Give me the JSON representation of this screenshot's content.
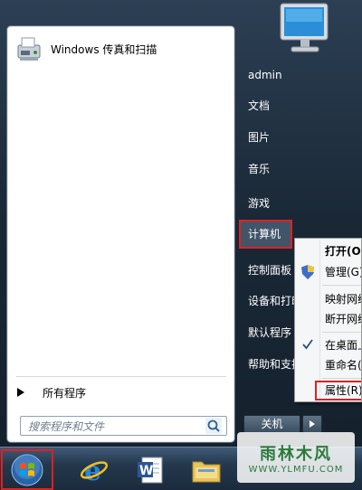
{
  "start_menu": {
    "pinned_item_label": "Windows 传真和扫描",
    "all_programs_label": "所有程序",
    "search_placeholder": "搜索程序和文件"
  },
  "right_pane": {
    "items": [
      {
        "label": "admin"
      },
      {
        "label": "文档"
      },
      {
        "label": "图片"
      },
      {
        "label": "音乐"
      },
      {
        "label": "游戏"
      },
      {
        "label": "计算机"
      },
      {
        "label": "控制面板"
      },
      {
        "label": "设备和打印机"
      },
      {
        "label": "默认程序"
      },
      {
        "label": "帮助和支持"
      }
    ],
    "shutdown_label": "关机"
  },
  "context_menu": {
    "items": [
      {
        "label": "打开(O)"
      },
      {
        "label": "管理(G)"
      },
      {
        "label": "映射网络驱动器"
      },
      {
        "label": "断开网络驱动器"
      },
      {
        "label": "在桌面上显示"
      },
      {
        "label": "重命名(M)"
      },
      {
        "label": "属性(R)"
      }
    ]
  },
  "watermark": {
    "title": "雨林木风",
    "url": "WWW.YLMFU.COM"
  },
  "colors": {
    "highlight_border": "#e02020",
    "menu_text_right": "#ffffff"
  }
}
